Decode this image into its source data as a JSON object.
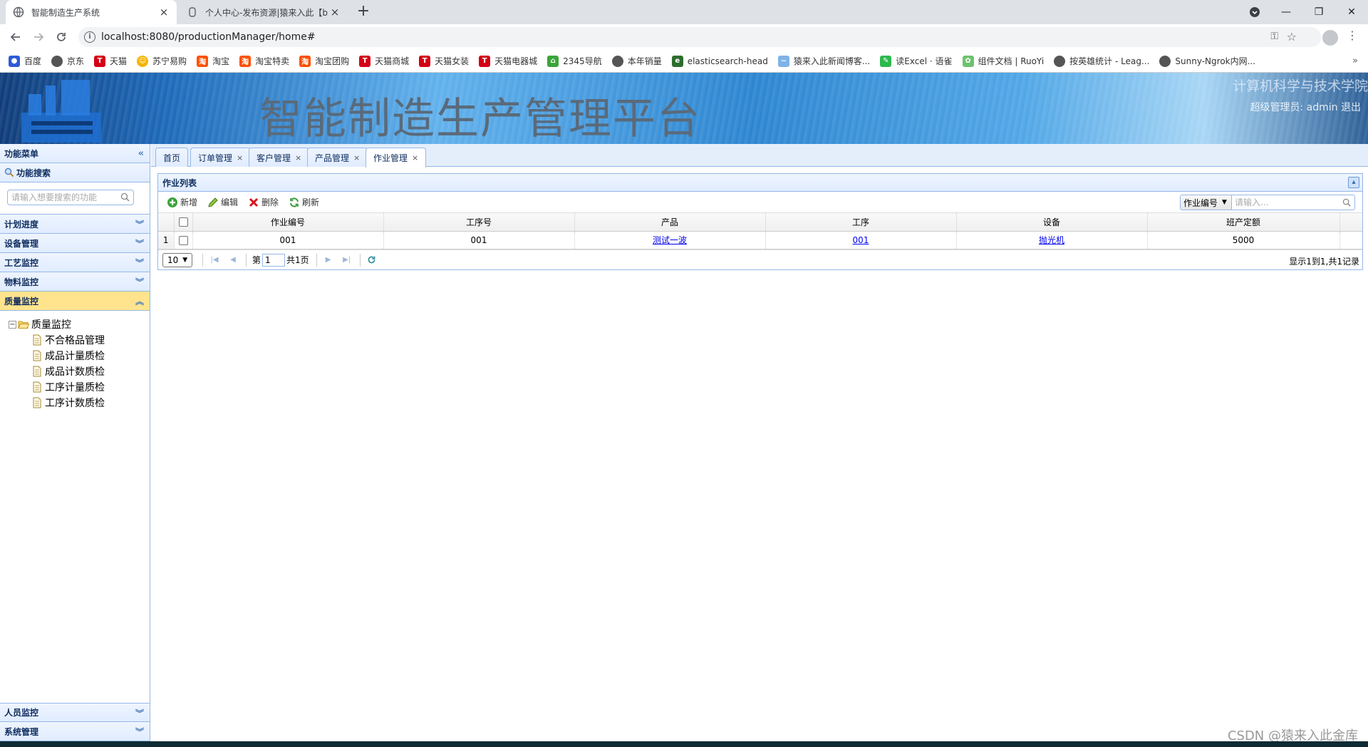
{
  "browser": {
    "tabs": [
      {
        "title": "智能制造生产系统",
        "active": true
      },
      {
        "title": "个人中心-发布资源|猿来入此【b",
        "active": false
      }
    ],
    "url": "localhost:8080/productionManager/home#",
    "bookmarks": [
      "百度",
      "京东",
      "天猫",
      "苏宁易购",
      "淘宝",
      "淘宝特卖",
      "淘宝团购",
      "天猫商城",
      "天猫女装",
      "天猫电器城",
      "2345导航",
      "本年销量",
      "elasticsearch-head",
      "猿来入此新闻博客...",
      "读Excel · 语雀",
      "组件文档 | RuoYi",
      "按英雄统计 - Leag...",
      "Sunny-Ngrok内网..."
    ],
    "bookmark_more": "»"
  },
  "banner": {
    "title": "智能制造生产管理平台",
    "college": "计算机科学与技术学院",
    "user": "超级管理员: admin   退出"
  },
  "sidebar": {
    "header": "功能菜单",
    "search_title": "功能搜索",
    "search_placeholder": "请输入想要搜索的功能",
    "sections": [
      "计划进度",
      "设备管理",
      "工艺监控",
      "物料监控",
      "质量监控"
    ],
    "selected_section": "质量监控",
    "tree_root": "质量监控",
    "tree_items": [
      "不合格品管理",
      "成品计量质检",
      "成品计数质检",
      "工序计量质检",
      "工序计数质检"
    ],
    "bottom_sections": [
      "人员监控",
      "系统管理"
    ]
  },
  "tabs": [
    {
      "label": "首页",
      "closable": false
    },
    {
      "label": "订单管理",
      "closable": true
    },
    {
      "label": "客户管理",
      "closable": true
    },
    {
      "label": "产品管理",
      "closable": true
    },
    {
      "label": "作业管理",
      "closable": true,
      "active": true
    }
  ],
  "tab_close": "×",
  "grid": {
    "title": "作业列表",
    "toolbar": [
      "新增",
      "编辑",
      "删除",
      "刷新"
    ],
    "search_field": "作业编号",
    "search_placeholder": "请输入...",
    "columns": [
      "作业编号",
      "工序号",
      "产品",
      "工序",
      "设备",
      "班产定额"
    ],
    "rows": [
      {
        "rownum": "1",
        "cells": [
          "001",
          "001",
          "测试一波",
          "001",
          "抛光机",
          "5000"
        ]
      }
    ],
    "page_size": "10",
    "page_prefix": "第",
    "page_value": "1",
    "page_total": "共1页",
    "info": "显示1到1,共1记录"
  },
  "watermark": "CSDN @猿来入此金库",
  "colors": {
    "panel_border": "#95b8e7",
    "panel_header": "#e0ecff",
    "selected_section": "#ffe48d",
    "link": "#0000ee"
  }
}
